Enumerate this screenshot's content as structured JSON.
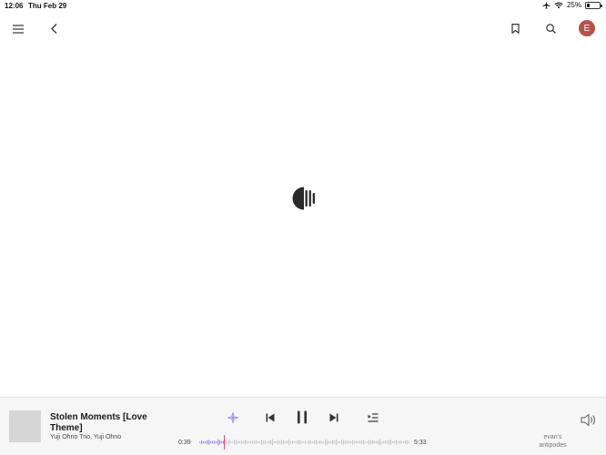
{
  "status_bar": {
    "time": "12:06",
    "date": "Thu Feb 29",
    "battery_text": "25%",
    "battery_level": 0.25,
    "icons": [
      "airplane-icon",
      "wifi-icon",
      "battery-icon"
    ]
  },
  "header": {
    "icons": [
      "menu-icon",
      "back-icon",
      "bookmark-icon",
      "search-icon"
    ],
    "avatar_initial": "E",
    "avatar_color": "#b5534a"
  },
  "main": {
    "loader_icon": "loading-logo-icon"
  },
  "player": {
    "title": "Stolen Moments [Love Theme]",
    "artist": "Yuji Ohno Trio, Yuji Ohno",
    "elapsed": "0:39",
    "duration": "5:33",
    "progress": 0.117,
    "station_line1": "evan's",
    "station_line2": "antipodes",
    "accent_color": "#9d8cf0",
    "playhead_color": "#e0455a",
    "icons": [
      "sparkle-icon",
      "previous-icon",
      "pause-icon",
      "next-icon",
      "queue-icon",
      "volume-icon"
    ]
  }
}
